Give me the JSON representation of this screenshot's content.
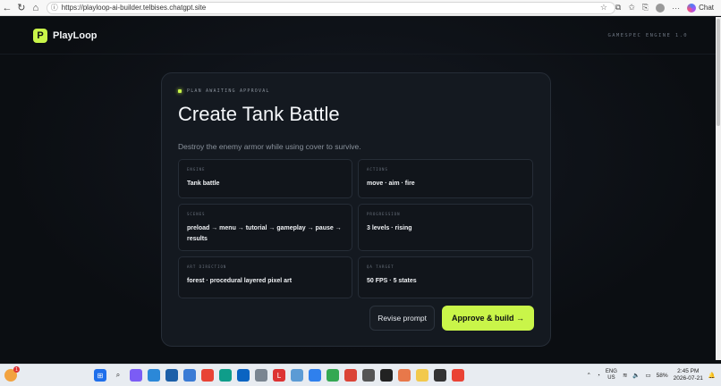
{
  "browser": {
    "url": "https://playloop-ai-builder.telbises.chatgpt.site",
    "chat_label": "Chat"
  },
  "app": {
    "logo_letter": "P",
    "name": "PlayLoop",
    "engine_version": "GAMESPEC ENGINE 1.0",
    "accent_color": "#c9f549"
  },
  "plan": {
    "status": "PLAN AWAITING APPROVAL",
    "title": "Create Tank Battle",
    "subtitle": "Destroy the enemy armor while using cover to survive.",
    "tiles": [
      {
        "label": "ENGINE",
        "value": "Tank battle"
      },
      {
        "label": "ACTIONS",
        "value": "move · aim · fire"
      },
      {
        "label": "SCENES",
        "value": "preload → menu → tutorial → gameplay → pause → results"
      },
      {
        "label": "PROGRESSION",
        "value": "3 levels · rising"
      },
      {
        "label": "ART DIRECTION",
        "value": "forest · procedural layered pixel art"
      },
      {
        "label": "QA TARGET",
        "value": "50 FPS · 5 states"
      }
    ],
    "revise_label": "Revise prompt",
    "approve_label": "Approve & build →"
  },
  "taskbar": {
    "weather_badge": "1",
    "language": "ENG",
    "region": "US",
    "battery": "58%",
    "time": "2:45 PM",
    "date": "2026-07-21"
  }
}
